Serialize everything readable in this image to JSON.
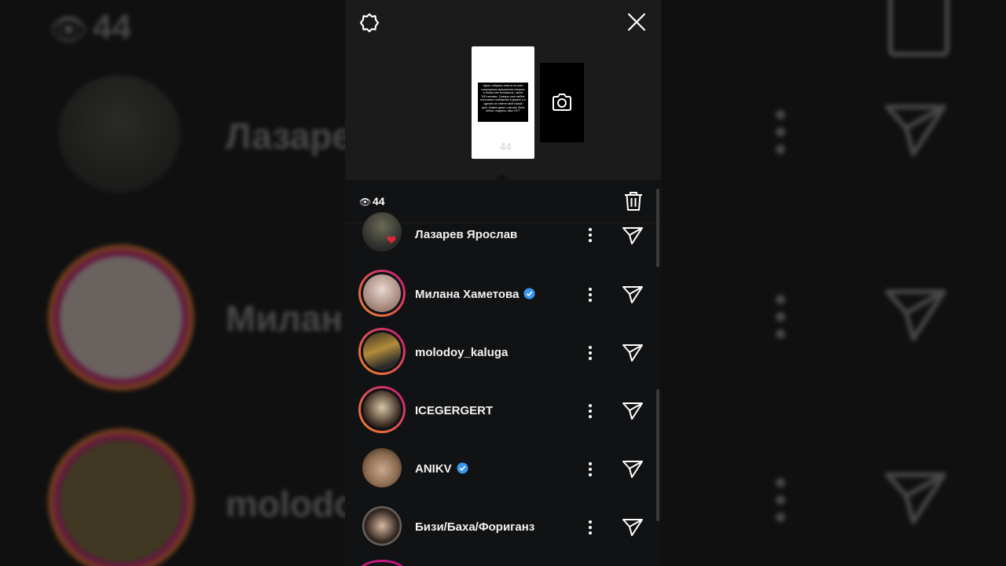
{
  "viewer": {
    "count": "44",
    "eye_icon": "eye-icon"
  },
  "story": {
    "thumbnail_text": "Здесь собраны ответы на всех популярных музыкантов которых я только мог вспомнить, около 100 человек. Скинуть мне любое голосовое сообщение в директ и я сделаю из ответа свой новый трек. Можно даже с фитом. Всех обнял, подпись, ваш 1977",
    "view_count": "44"
  },
  "viewers": [
    {
      "name": "Лазарев Ярослав",
      "verified": false,
      "ring": "none",
      "liked": true
    },
    {
      "name": "Милана Хаметова",
      "verified": true,
      "ring": "gradient"
    },
    {
      "name": "molodoy_kaluga",
      "verified": false,
      "ring": "gradient"
    },
    {
      "name": "ICEGERGERT",
      "verified": false,
      "ring": "gradient"
    },
    {
      "name": "ANIKV",
      "verified": true,
      "ring": "none"
    },
    {
      "name": "Бизи/Баха/Фориганз",
      "verified": false,
      "ring": "none"
    }
  ],
  "background": {
    "names": [
      "Лазаре",
      "Милан",
      "molodo"
    ],
    "count": "44"
  },
  "colors": {
    "verified": "#3897f0",
    "heart": "#e0243a",
    "ring_from": "#f58529",
    "ring_to": "#c2187d"
  }
}
